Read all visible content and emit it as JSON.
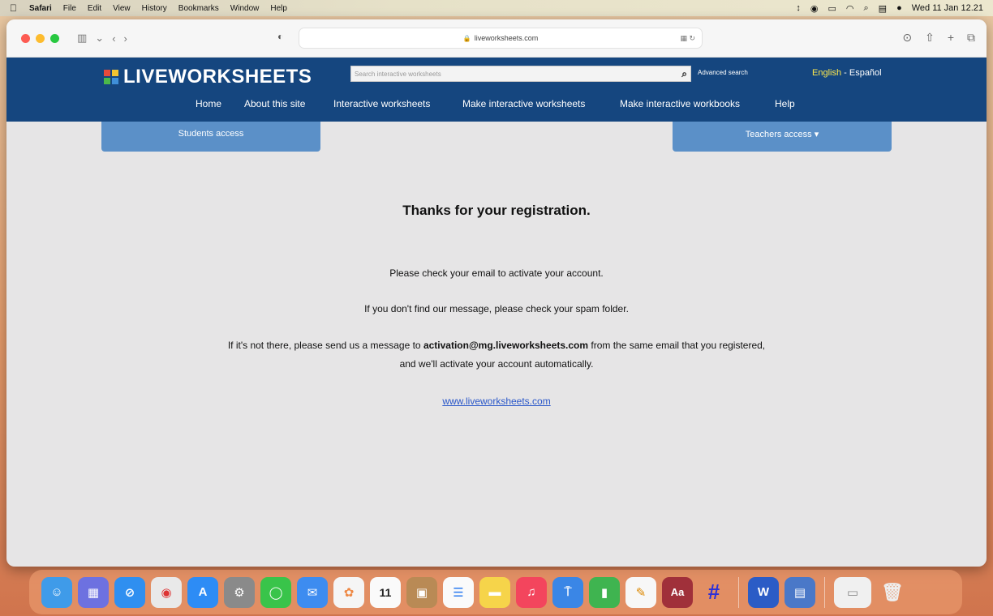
{
  "menubar": {
    "app": "Safari",
    "items": [
      "File",
      "Edit",
      "View",
      "History",
      "Bookmarks",
      "Window",
      "Help"
    ],
    "datetime": "Wed 11 Jan 12.21"
  },
  "browser": {
    "url": "liveworksheets.com"
  },
  "site": {
    "logo": "LIVEWORKSHEETS",
    "search_placeholder": "Search interactive worksheets",
    "advanced_search": "Advanced search",
    "lang_en": "English",
    "lang_sep": " - ",
    "lang_es": "Español",
    "nav": [
      "Home",
      "About this site",
      "Interactive worksheets",
      "Make interactive worksheets",
      "Make interactive workbooks",
      "Help"
    ],
    "students_access": "Students access",
    "teachers_access": "Teachers access ▾"
  },
  "main": {
    "heading": "Thanks for your registration.",
    "line1": "Please check your email to activate your account.",
    "line2": "If you don't find our message, please check your spam folder.",
    "line3_pre": "If it's not there, please send us a message to ",
    "line3_email": "activation@mg.liveworksheets.com",
    "line3_post": " from the same email that you registered,",
    "line4": "and we'll activate your account automatically.",
    "site_link": "www.liveworksheets.com"
  },
  "dock": {
    "calendar_day": "11",
    "dictionary_label": "Aa",
    "sketch_glyph": "#"
  }
}
